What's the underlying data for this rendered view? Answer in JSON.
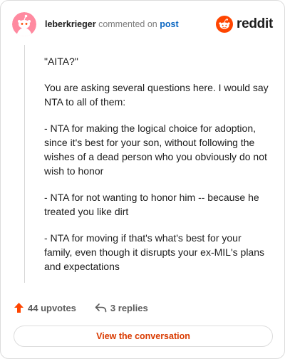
{
  "comment": {
    "author": "leberkrieger",
    "action": "commented on",
    "target_link": "post",
    "brand": "reddit",
    "paragraphs": [
      "\"AITA?\"",
      "You are asking several questions here. I would say NTA to all of them:",
      "- NTA for making the logical choice for adoption, since it's best for your son, without following the wishes of a dead person who you obviously do not wish to honor",
      "- NTA for not wanting to honor him -- because he treated you like dirt",
      "- NTA for moving if that's what's best for your family, even though it disrupts your ex-MIL's plans and expectations"
    ],
    "upvotes": "44 upvotes",
    "replies": "3 replies",
    "cta_label": "View the conversation"
  },
  "colors": {
    "brand_orange": "#ff4500",
    "avatar_bg": "#ff8aa0",
    "link_blue": "#0a66c2",
    "cta_text": "#d93a00",
    "upvote_arrow": "#ff4500"
  },
  "icons": {
    "avatar": "snoo-avatar-icon",
    "brand_logo": "reddit-snoo-icon",
    "upvote": "upvote-arrow-icon",
    "reply": "reply-arrow-icon"
  }
}
